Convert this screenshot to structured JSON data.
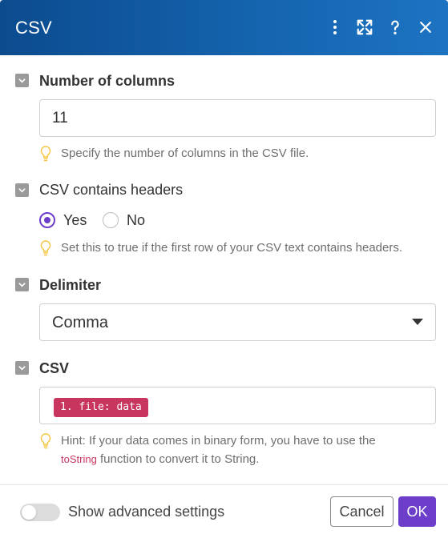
{
  "header": {
    "title": "CSV",
    "icons": [
      "more-vertical-icon",
      "expand-icon",
      "help-icon",
      "close-icon"
    ],
    "color": "#1565b0"
  },
  "sections": {
    "columns": {
      "label": "Number of columns",
      "value": "11",
      "hint": "Specify the number of columns in the CSV file."
    },
    "headers": {
      "label": "CSV contains headers",
      "options": [
        "Yes",
        "No"
      ],
      "selected": "Yes",
      "hint": "Set this to true if the first row of your CSV text contains headers."
    },
    "delimiter": {
      "label": "Delimiter",
      "selected": "Comma"
    },
    "csv": {
      "label": "CSV",
      "token": "1. file: data",
      "hint_line1": "Hint: If your data comes in binary form, you have to use the",
      "hint_code": "toString",
      "hint_line2_rest": " function to convert it to String."
    }
  },
  "footer": {
    "toggle_label": "Show advanced settings",
    "toggle_on": false,
    "cancel_label": "Cancel",
    "ok_label": "OK"
  },
  "colors": {
    "accent": "#6d3ec9",
    "token": "#c8365f",
    "hint_icon": "#f5c542"
  }
}
